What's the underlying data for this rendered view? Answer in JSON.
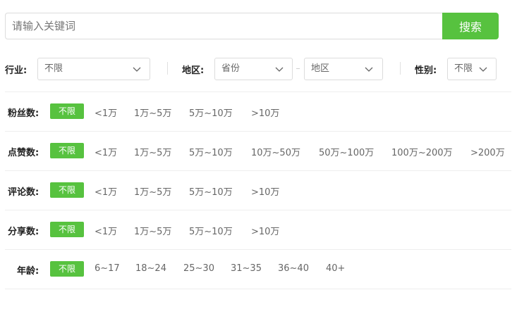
{
  "search": {
    "placeholder": "请输入关键词",
    "button_label": "搜索"
  },
  "filters": {
    "industry": {
      "label": "行业:",
      "value": "不限"
    },
    "region": {
      "label": "地区:",
      "province": "省份",
      "area": "地区"
    },
    "gender": {
      "label": "性别:",
      "value": "不限"
    }
  },
  "rows": {
    "fans": {
      "label": "粉丝数:",
      "active": "不限",
      "options": [
        "<1万",
        "1万~5万",
        "5万~10万",
        ">10万"
      ]
    },
    "likes": {
      "label": "点赞数:",
      "active": "不限",
      "options": [
        "<1万",
        "1万~5万",
        "5万~10万",
        "10万~50万",
        "50万~100万",
        "100万~200万",
        ">200万"
      ]
    },
    "comments": {
      "label": "评论数:",
      "active": "不限",
      "options": [
        "<1万",
        "1万~5万",
        "5万~10万",
        ">10万"
      ]
    },
    "shares": {
      "label": "分享数:",
      "active": "不限",
      "options": [
        "<1万",
        "1万~5万",
        "5万~10万",
        ">10万"
      ]
    },
    "age": {
      "label": "年龄:",
      "active": "不限",
      "options": [
        "6~17",
        "18~24",
        "25~30",
        "31~35",
        "36~40",
        "40+"
      ]
    }
  },
  "colors": {
    "accent": "#57c23f",
    "border": "#dcdcdc"
  },
  "icons": {
    "dropdown": "chevron-down-icon"
  }
}
